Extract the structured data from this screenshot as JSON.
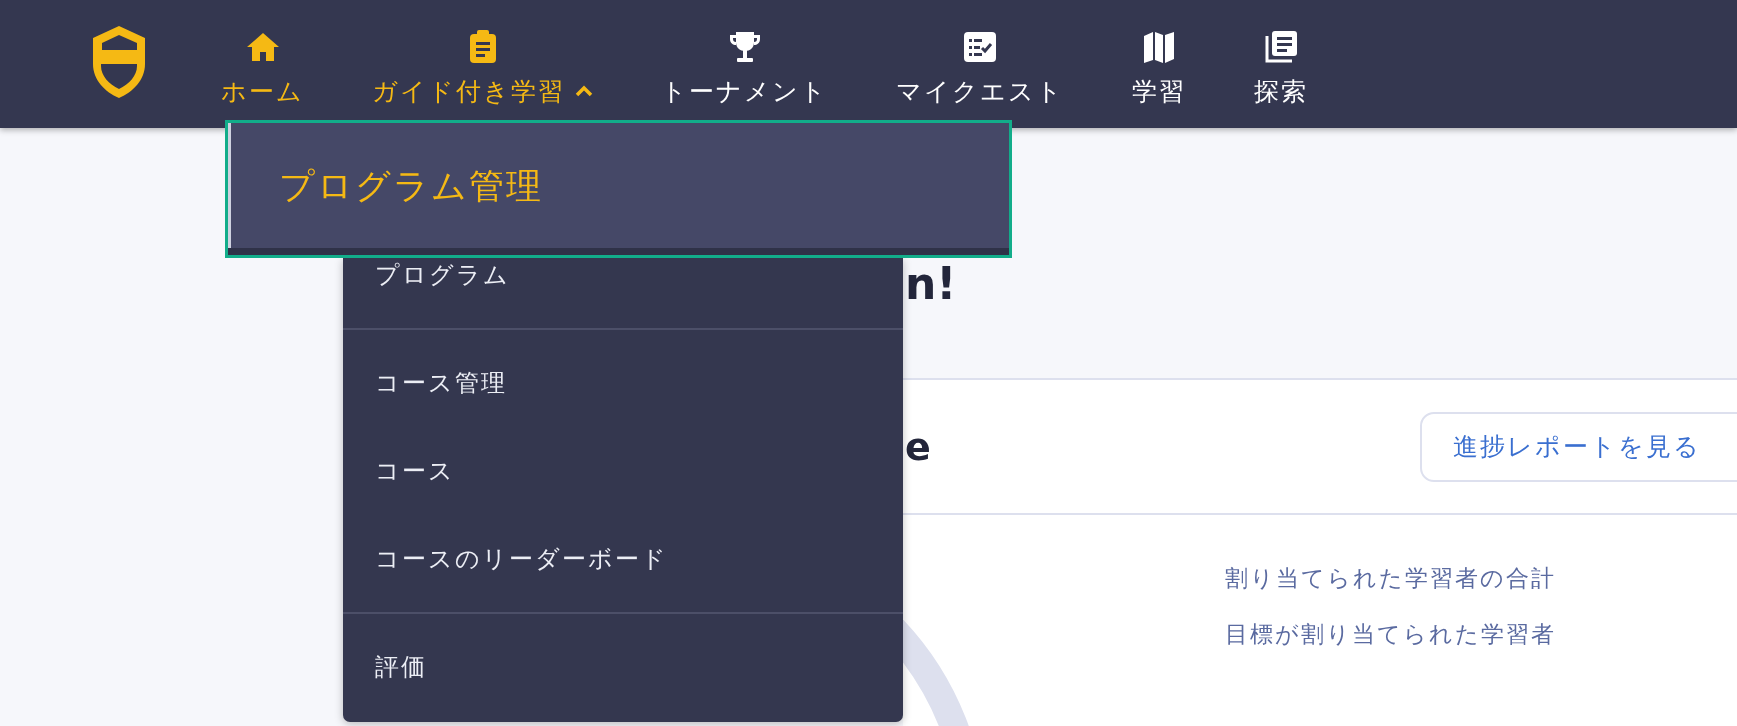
{
  "nav": {
    "items": [
      {
        "label": "ホーム",
        "highlighted": true,
        "expanded": false
      },
      {
        "label": "ガイド付き学習",
        "highlighted": true,
        "expanded": true
      },
      {
        "label": "トーナメント",
        "highlighted": false,
        "expanded": false
      },
      {
        "label": "マイクエスト",
        "highlighted": false,
        "expanded": false
      },
      {
        "label": "学習",
        "highlighted": false,
        "expanded": false
      },
      {
        "label": "探索",
        "highlighted": false,
        "expanded": false
      }
    ]
  },
  "dropdown": {
    "items": [
      {
        "label": "プログラム管理",
        "focused": true,
        "divider_before": false
      },
      {
        "label": "プログラム",
        "focused": false,
        "divider_before": false
      },
      {
        "label": "コース管理",
        "focused": false,
        "divider_before": true
      },
      {
        "label": "コース",
        "focused": false,
        "divider_before": false
      },
      {
        "label": "コースのリーダーボード",
        "focused": false,
        "divider_before": false
      },
      {
        "label": "評価",
        "focused": false,
        "divider_before": true
      }
    ]
  },
  "heading": "n!",
  "card": {
    "title": "e",
    "button": "進捗レポートを見る",
    "stats": [
      "割り当てられた学習者の合計",
      "目標が割り当てられた学習者"
    ]
  }
}
